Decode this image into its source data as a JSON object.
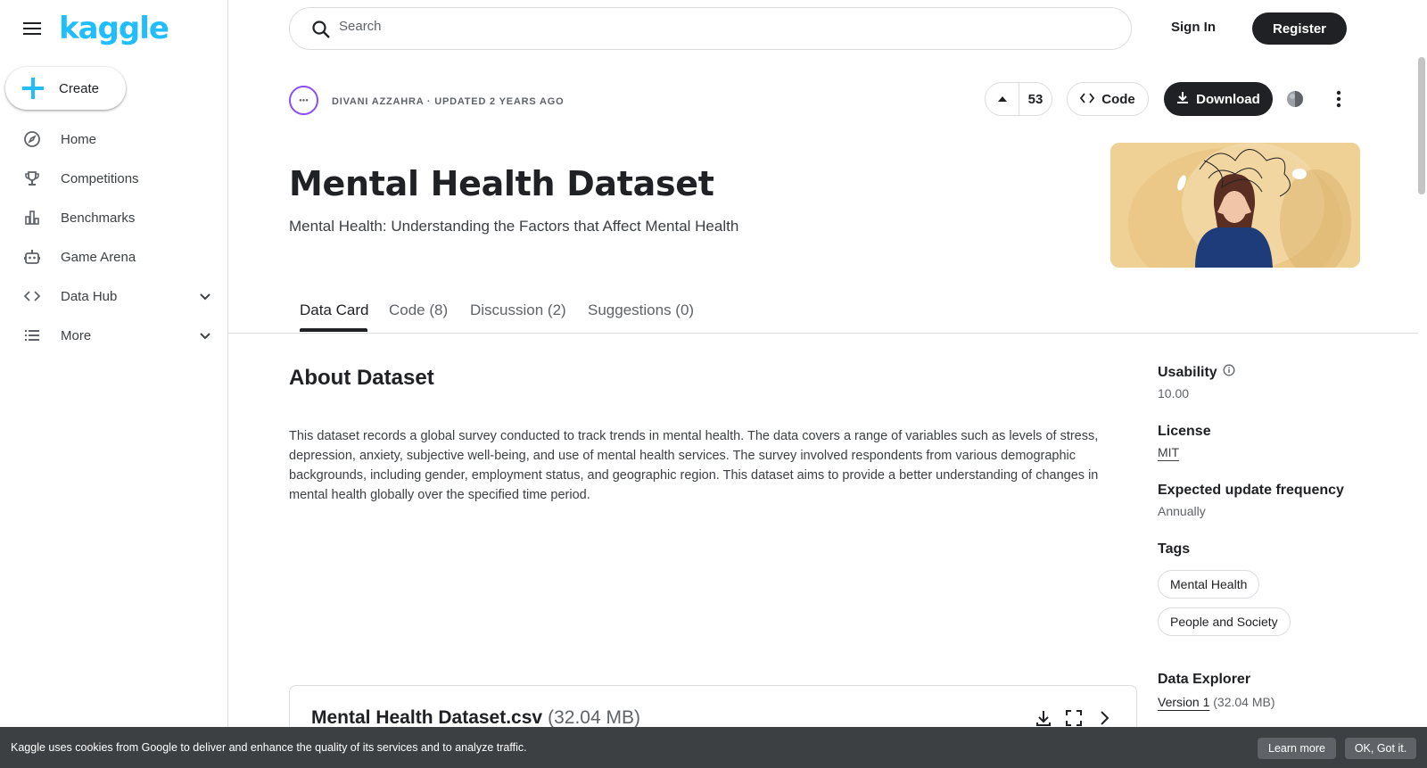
{
  "brand": {
    "logo": "kaggle",
    "accent": "#20beff"
  },
  "sidebar": {
    "create_label": "Create",
    "items": [
      {
        "label": "Home",
        "icon": "compass-icon"
      },
      {
        "label": "Competitions",
        "icon": "trophy-icon"
      },
      {
        "label": "Benchmarks",
        "icon": "bar-chart-icon"
      },
      {
        "label": "Game Arena",
        "icon": "robot-icon"
      },
      {
        "label": "Data Hub",
        "icon": "code-icon"
      },
      {
        "label": "More",
        "icon": "list-icon"
      }
    ]
  },
  "topbar": {
    "search_placeholder": "Search",
    "sign_in": "Sign In",
    "register": "Register"
  },
  "dataset": {
    "owner_line": "DIVANI AZZAHRA · UPDATED 2 YEARS AGO",
    "upvotes": "53",
    "code_label": "Code",
    "download_label": "Download",
    "title": "Mental Health Dataset",
    "subtitle": "Mental Health: Understanding the Factors that Affect Mental Health"
  },
  "tabs": [
    {
      "label": "Data Card",
      "active": true
    },
    {
      "label": "Code (8)",
      "active": false
    },
    {
      "label": "Discussion (2)",
      "active": false
    },
    {
      "label": "Suggestions (0)",
      "active": false
    }
  ],
  "about": {
    "heading": "About Dataset",
    "body": "This dataset records a global survey conducted to track trends in mental health. The data covers a range of variables such as levels of stress, depression, anxiety, subjective well-being, and use of mental health services. The survey involved respondents from various demographic backgrounds, including gender, employment status, and geographic region. This dataset aims to provide a better understanding of changes in mental health globally over the specified time period."
  },
  "meta": {
    "usability_label": "Usability",
    "usability_value": "10.00",
    "license_label": "License",
    "license_value": "MIT",
    "frequency_label": "Expected update frequency",
    "frequency_value": "Annually",
    "tags_label": "Tags",
    "tags": [
      "Mental Health",
      "People and Society"
    ],
    "explorer_label": "Data Explorer",
    "explorer_version": "Version 1",
    "explorer_size": "(32.04 MB)"
  },
  "file": {
    "name": "Mental Health Dataset.csv",
    "size": "(32.04 MB)"
  },
  "cookie": {
    "message": "Kaggle uses cookies from Google to deliver and enhance the quality of its services and to analyze traffic.",
    "learn_more": "Learn more",
    "ok": "OK, Got it."
  }
}
